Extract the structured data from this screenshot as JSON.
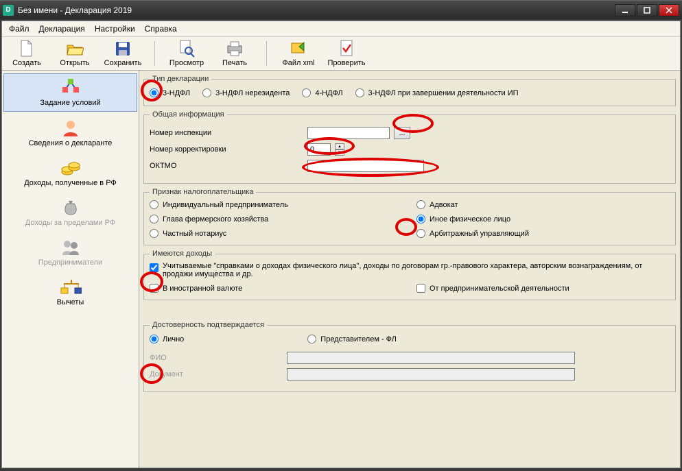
{
  "window": {
    "title": "Без имени - Декларация 2019"
  },
  "menu": {
    "file": "Файл",
    "declaration": "Декларация",
    "settings": "Настройки",
    "help": "Справка"
  },
  "toolbar": {
    "create": "Создать",
    "open": "Открыть",
    "save": "Сохранить",
    "preview": "Просмотр",
    "print": "Печать",
    "filexml": "Файл xml",
    "check": "Проверить"
  },
  "sidebar": {
    "conditions": "Задание условий",
    "declarant": "Сведения о декларанте",
    "income_rf": "Доходы, полученные в РФ",
    "income_abroad": "Доходы за пределами РФ",
    "entrepreneurs": "Предприниматели",
    "deductions": "Вычеты"
  },
  "decl_type": {
    "legend": "Тип декларации",
    "ndfl3": "3-НДФЛ",
    "ndfl3_nr": "3-НДФЛ нерезидента",
    "ndfl4": "4-НДФЛ",
    "ndfl3_end": "3-НДФЛ при завершении деятельности ИП"
  },
  "general": {
    "legend": "Общая информация",
    "inspection": "Номер инспекции",
    "correction": "Номер корректировки",
    "correction_val": "0",
    "oktmo": "ОКТМО"
  },
  "taxpayer": {
    "legend": "Признак налогоплательщика",
    "ip": "Индивидуальный предприниматель",
    "advocate": "Адвокат",
    "farm": "Глава фермерского хозяйства",
    "other": "Иное физическое лицо",
    "notary": "Частный нотариус",
    "arbitr": "Арбитражный управляющий"
  },
  "income": {
    "legend": "Имеются доходы",
    "cb1": "Учитываемые \"справками о доходах физического лица\", доходы по договорам гр.-правового характера, авторским вознаграждениям, от продажи имущества и др.",
    "cb2": "В иностранной валюте",
    "cb3": "От предпринимательской деятельности"
  },
  "confirm": {
    "legend": "Достоверность подтверждается",
    "self": "Лично",
    "rep": "Представителем - ФЛ",
    "fio": "ФИО",
    "doc": "Документ"
  }
}
